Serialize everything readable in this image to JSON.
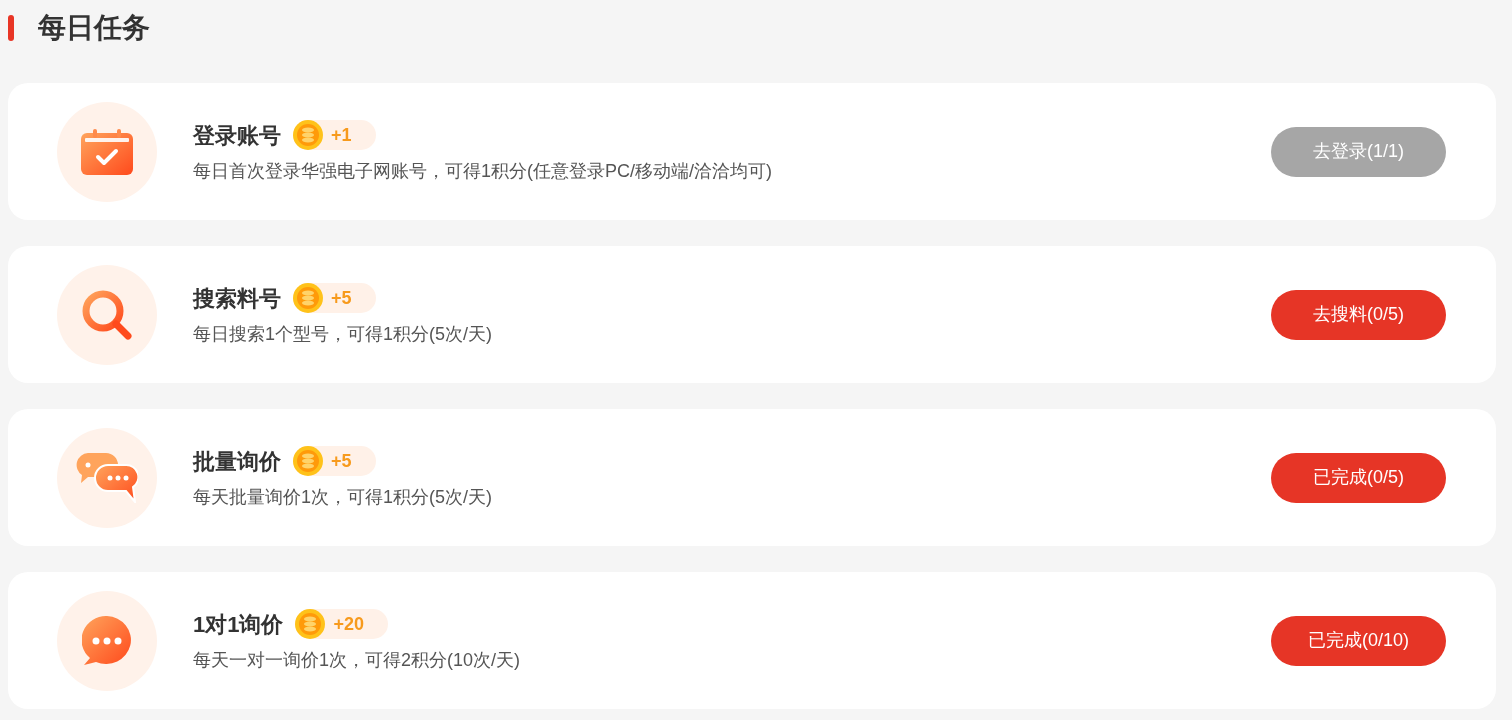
{
  "header": {
    "title": "每日任务"
  },
  "tasks": [
    {
      "kind": "calendar",
      "title": "登录账号",
      "points": "+1",
      "description": "每日首次登录华强电子网账号，可得1积分(任意登录PC/移动端/洽洽均可)",
      "button": "去登录(1/1)",
      "disabled": true
    },
    {
      "kind": "search",
      "title": "搜索料号",
      "points": "+5",
      "description": "每日搜索1个型号，可得1积分(5次/天)",
      "button": "去搜料(0/5)",
      "disabled": false
    },
    {
      "kind": "chats",
      "title": "批量询价",
      "points": "+5",
      "description": "每天批量询价1次，可得1积分(5次/天)",
      "button": "已完成(0/5)",
      "disabled": false
    },
    {
      "kind": "chat",
      "title": "1对1询价",
      "points": "+20",
      "description": "每天一对一询价1次，可得2积分(10次/天)",
      "button": "已完成(0/10)",
      "disabled": false
    }
  ]
}
